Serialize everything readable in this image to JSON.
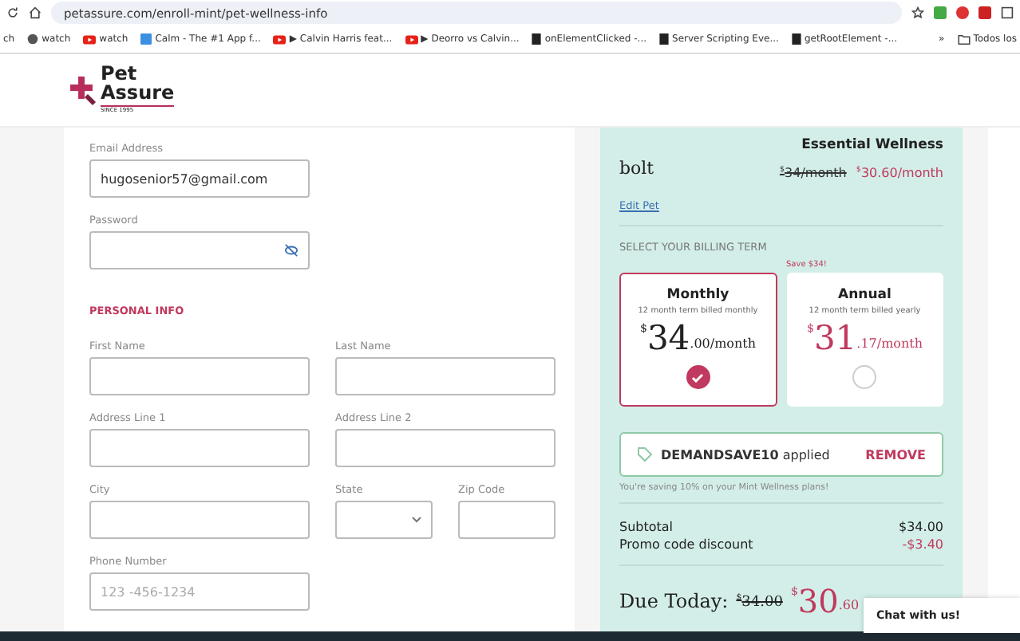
{
  "browser": {
    "url": "petassure.com/enroll-mint/pet-wellness-info"
  },
  "bookmarks": [
    {
      "label": "ch"
    },
    {
      "label": "watch"
    },
    {
      "label": "watch"
    },
    {
      "label": "Calm - The #1 App f..."
    },
    {
      "label": "▶ Calvin Harris feat..."
    },
    {
      "label": "▶ Deorro vs Calvin..."
    },
    {
      "label": "onElementClicked -..."
    },
    {
      "label": "Server Scripting Eve..."
    },
    {
      "label": "getRootElement -..."
    }
  ],
  "bookmarks_more": "»",
  "bookmarks_folder": "Todos los",
  "logo": {
    "line1": "Pet",
    "line2": "Assure",
    "tagline": "SINCE 1995"
  },
  "form": {
    "email": {
      "label": "Email Address",
      "value": "hugosenior57@gmail.com"
    },
    "password": {
      "label": "Password"
    },
    "section_title": "PERSONAL INFO",
    "first_name": {
      "label": "First Name"
    },
    "last_name": {
      "label": "Last Name"
    },
    "address1": {
      "label": "Address Line 1"
    },
    "address2": {
      "label": "Address Line 2"
    },
    "city": {
      "label": "City"
    },
    "state": {
      "label": "State"
    },
    "zip": {
      "label": "Zip Code"
    },
    "phone": {
      "label": "Phone Number",
      "placeholder": "123 -456-1234"
    }
  },
  "summary": {
    "plan_name": "Essential Wellness",
    "pet_name": "bolt",
    "old_price": {
      "currency": "$",
      "amount": "34/month"
    },
    "new_price": {
      "currency": "$",
      "amount": "30.60/month"
    },
    "edit_link": "Edit Pet",
    "billing_title": "SELECT YOUR BILLING TERM",
    "plans": [
      {
        "name": "Monthly",
        "term": "12 month term billed monthly",
        "currency": "$",
        "whole": "34",
        "fraction": ".00/month",
        "selected": true
      },
      {
        "name": "Annual",
        "term": "12 month term billed yearly",
        "currency": "$",
        "whole": "31",
        "fraction": ".17/month",
        "selected": false,
        "badge": "Save $34!"
      }
    ],
    "promo": {
      "code": "DEMANDSAVE10",
      "status": "applied",
      "action": "REMOVE",
      "note": "You're saving 10% on your Mint Wellness plans!"
    },
    "lines": [
      {
        "label": "Subtotal",
        "value": "$34.00",
        "kind": "normal"
      },
      {
        "label": "Promo code discount",
        "value": "-$3.40",
        "kind": "discount"
      }
    ],
    "due": {
      "label": "Due Today:",
      "old_currency": "$",
      "old_amount": "34.00",
      "currency": "$",
      "whole": "30",
      "fraction": ".60"
    }
  },
  "chat": {
    "label": "Chat with us!"
  }
}
